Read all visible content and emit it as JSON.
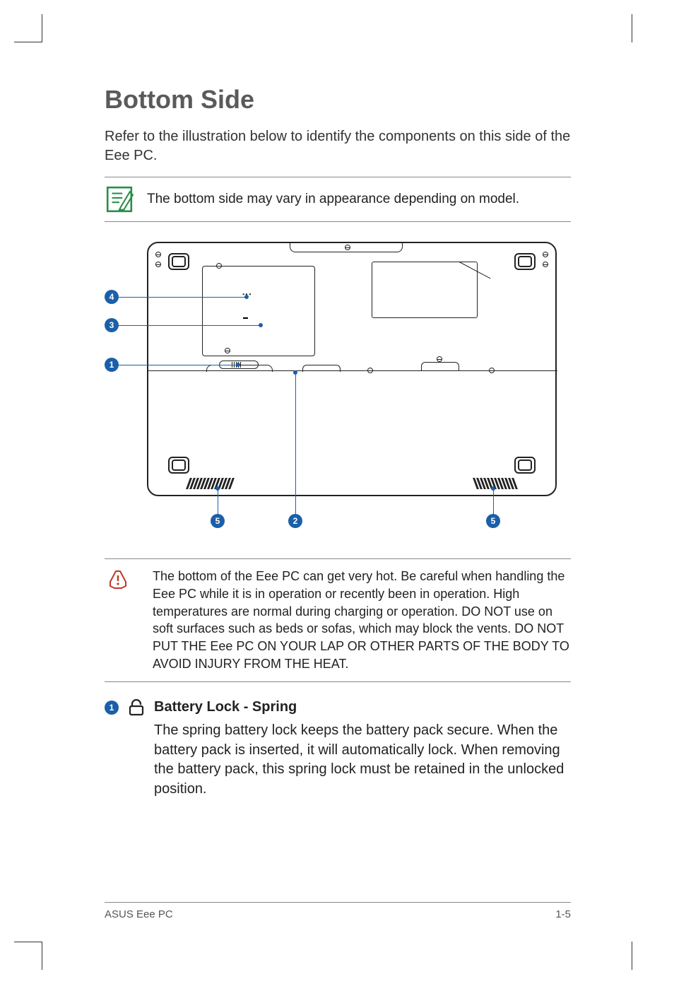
{
  "heading": "Bottom Side",
  "intro": "Refer to the illustration below to identify the components on this side of the Eee PC.",
  "note": "The bottom side may vary in appearance depending on model.",
  "callouts": {
    "c1": "1",
    "c2": "2",
    "c3": "3",
    "c4": "4",
    "c5a": "5",
    "c5b": "5"
  },
  "warning": "The bottom of the Eee PC can get very hot. Be careful when handling the Eee PC while it is in operation or recently been in operation. High temperatures are normal during charging or operation. DO NOT use on soft surfaces such as beds or sofas, which may block the vents. DO NOT PUT THE Eee PC ON YOUR LAP OR OTHER PARTS OF THE BODY TO AVOID INJURY FROM THE HEAT.",
  "item1": {
    "num": "1",
    "title": "Battery Lock - Spring",
    "desc": "The spring battery lock keeps the battery pack secure. When the battery pack is inserted, it will automatically lock. When removing the battery pack, this spring lock must be retained in the unlocked position."
  },
  "footer": {
    "left": "ASUS Eee PC",
    "right": "1-5"
  }
}
